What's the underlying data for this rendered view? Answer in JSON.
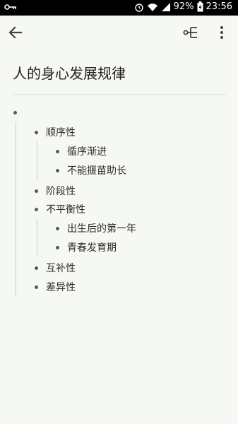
{
  "status_bar": {
    "battery_percent": "92%",
    "time": "23:56",
    "icons": [
      "key-icon",
      "alarm-icon",
      "wifi-icon",
      "signal-icon",
      "battery-icon"
    ]
  },
  "app_bar": {
    "icons": [
      "back-arrow-icon",
      "mindmap-icon",
      "more-vert-icon"
    ]
  },
  "document": {
    "title": "人的身心发展规律",
    "root": {
      "text": "",
      "children": [
        {
          "text": "顺序性",
          "children": [
            {
              "text": "循序渐进"
            },
            {
              "text": "不能揠苗助长"
            }
          ]
        },
        {
          "text": "阶段性"
        },
        {
          "text": "不平衡性",
          "children": [
            {
              "text": "出生后的第一年"
            },
            {
              "text": "青春发育期"
            }
          ]
        },
        {
          "text": "互补性"
        },
        {
          "text": "差异性"
        }
      ]
    }
  }
}
